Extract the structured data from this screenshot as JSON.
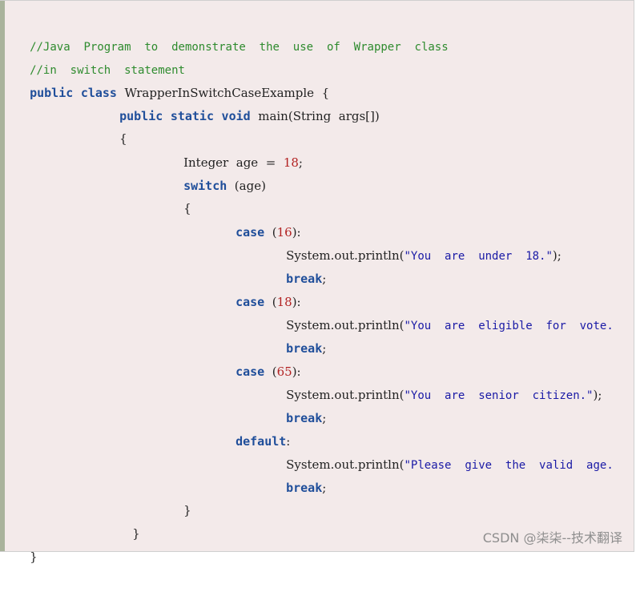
{
  "code": {
    "line1": {
      "comment": "//Java  Program  to  demonstrate  the  use  of  Wrapper  class"
    },
    "line2": {
      "comment": "//in  switch  statement"
    },
    "line3": {
      "kw1": "public",
      "kw2": "class",
      "text": "WrapperInSwitchCaseExample  {"
    },
    "line4": {
      "kw1": "public",
      "kw2": "static",
      "kw3": "void",
      "text": "main(String  args[])"
    },
    "line5": {
      "text": "{"
    },
    "line6": {
      "text": "Integer  age  =  ",
      "num": "18",
      "end": ";"
    },
    "line7": {
      "kw": "switch",
      "text": "  (age)"
    },
    "line8": {
      "text": "{"
    },
    "line9": {
      "kw": "case",
      "open": "  (",
      "num": "16",
      "close": "):"
    },
    "line10": {
      "text": "System.out.println(",
      "str": "\"You  are  under  18.\"",
      "end": ");"
    },
    "line11": {
      "kw": "break",
      "end": ";"
    },
    "line12": {
      "kw": "case",
      "open": "  (",
      "num": "18",
      "close": "):"
    },
    "line13": {
      "text": "System.out.println(",
      "str": "\"You  are  eligible  for  vote."
    },
    "line14": {
      "kw": "break",
      "end": ";"
    },
    "line15": {
      "kw": "case",
      "open": "  (",
      "num": "65",
      "close": "):"
    },
    "line16": {
      "text": "System.out.println(",
      "str": "\"You  are  senior  citizen.\"",
      "end": ");"
    },
    "line17": {
      "kw": "break",
      "end": ";"
    },
    "line18": {
      "kw": "default",
      "end": ":"
    },
    "line19": {
      "text": "System.out.println(",
      "str": "\"Please  give  the  valid  age."
    },
    "line20": {
      "kw": "break",
      "end": ";"
    },
    "line21": {
      "text": "}"
    },
    "line22": {
      "text": "}"
    },
    "line23": {
      "text": "}"
    }
  },
  "watermark": "CSDN @柒柒--技术翻译",
  "colors": {
    "background": "#f3eaea",
    "left_bar": "#a9b39c",
    "keyword": "#1f4e9a",
    "comment": "#2e8b2e",
    "number": "#b22222",
    "string": "#1a1aa6"
  }
}
